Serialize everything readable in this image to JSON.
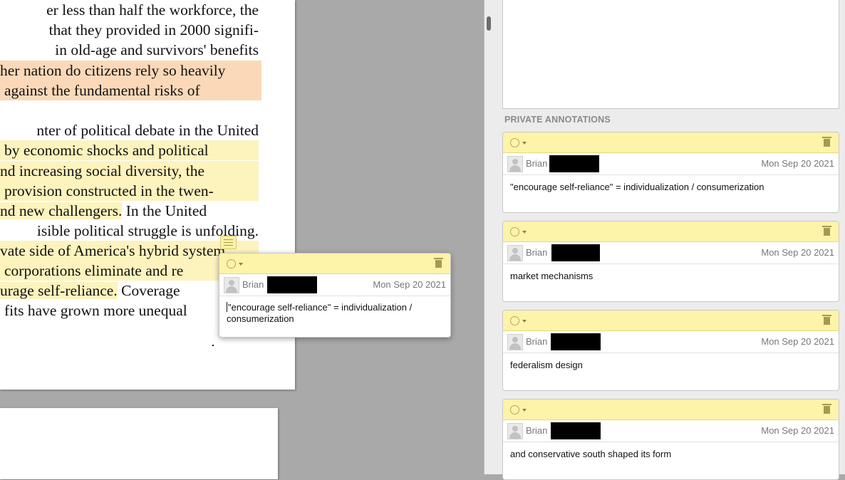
{
  "document": {
    "lines": [
      {
        "text": "er less than half the workforce, the",
        "hl": ""
      },
      {
        "text": "that they provided in 2000 signifi-",
        "hl": ""
      },
      {
        "text": "in old-age and survivors' benefits",
        "hl": ""
      },
      {
        "text": "her nation do citizens rely so heavily",
        "hl": "orange"
      },
      {
        "text": "against the fundamental risks of",
        "hl": "orange"
      },
      {
        "text": "nter of political debate in the United",
        "hl": ""
      },
      {
        "text": "by economic shocks and political",
        "hl": "yellow"
      },
      {
        "text": "nd increasing social diversity, the",
        "hl": "yellow"
      },
      {
        "text": "provision constructed in the twen-",
        "hl": "yellow"
      },
      {
        "pre": "nd new challengers.",
        "post": " In the United",
        "hl": "partial"
      },
      {
        "text": "isible political struggle is unfolding.",
        "hl": ""
      },
      {
        "text": "vate side of America's hybrid system",
        "hl": "yellow"
      },
      {
        "text": "corporations eliminate and re",
        "hl": "yellow"
      },
      {
        "pre": "urage self-reliance.",
        "post": " Coverage",
        "hl": "partial"
      },
      {
        "text": "fits have grown more unequal",
        "hl": ""
      }
    ]
  },
  "popup": {
    "user": "Brian",
    "date": "Mon Sep 20 2021",
    "text": "\"encourage self-reliance\" = individualization / consumerization"
  },
  "sidebar": {
    "section_title": "PRIVATE ANNOTATIONS",
    "annotations": [
      {
        "user": "Brian",
        "date": "Mon Sep 20 2021",
        "text": "\"encourage self-reliance\" = individualization / consumerization"
      },
      {
        "user": "Brian",
        "date": "Mon Sep 20 2021",
        "text": "market mechanisms"
      },
      {
        "user": "Brian",
        "date": "Mon Sep 20 2021",
        "text": "federalism design"
      },
      {
        "user": "Brian",
        "date": "Mon Sep 20 2021",
        "text": "and conservative south shaped its form"
      }
    ]
  },
  "colors": {
    "header_yellow": "#fdf3a9",
    "highlight_yellow": "#fdf3bd",
    "highlight_orange": "#fbd9b8",
    "viewer_gray": "#a9a9a9",
    "sidebar_bg": "#ececec"
  },
  "icons": [
    "circle-icon",
    "caret-down-icon",
    "trash-icon",
    "avatar-icon",
    "note-icon"
  ]
}
